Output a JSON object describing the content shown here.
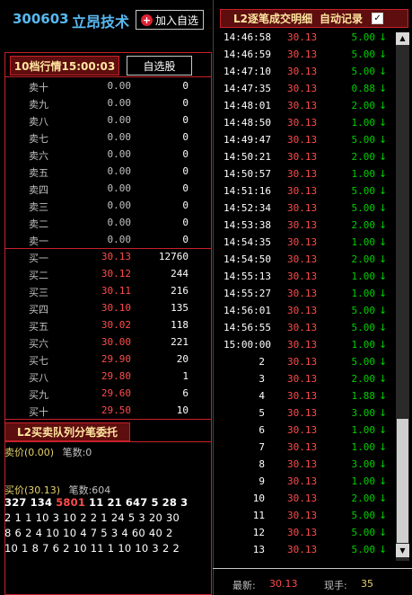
{
  "header": {
    "code": "300603",
    "name": "立昂技术",
    "add_button": "加入自选"
  },
  "tabs": {
    "quote10": "10档行情15:00:03",
    "favorites": "自选股"
  },
  "sells": [
    {
      "label": "卖十",
      "price": "0.00",
      "vol": "0"
    },
    {
      "label": "卖九",
      "price": "0.00",
      "vol": "0"
    },
    {
      "label": "卖八",
      "price": "0.00",
      "vol": "0"
    },
    {
      "label": "卖七",
      "price": "0.00",
      "vol": "0"
    },
    {
      "label": "卖六",
      "price": "0.00",
      "vol": "0"
    },
    {
      "label": "卖五",
      "price": "0.00",
      "vol": "0"
    },
    {
      "label": "卖四",
      "price": "0.00",
      "vol": "0"
    },
    {
      "label": "卖三",
      "price": "0.00",
      "vol": "0"
    },
    {
      "label": "卖二",
      "price": "0.00",
      "vol": "0"
    },
    {
      "label": "卖一",
      "price": "0.00",
      "vol": "0"
    }
  ],
  "buys": [
    {
      "label": "买一",
      "price": "30.13",
      "vol": "12760",
      "color": "red"
    },
    {
      "label": "买二",
      "price": "30.12",
      "vol": "244",
      "color": "red"
    },
    {
      "label": "买三",
      "price": "30.11",
      "vol": "216",
      "color": "red"
    },
    {
      "label": "买四",
      "price": "30.10",
      "vol": "135",
      "color": "red"
    },
    {
      "label": "买五",
      "price": "30.02",
      "vol": "118",
      "color": "red"
    },
    {
      "label": "买六",
      "price": "30.00",
      "vol": "221",
      "color": "red"
    },
    {
      "label": "买七",
      "price": "29.90",
      "vol": "20",
      "color": "red"
    },
    {
      "label": "买八",
      "price": "29.80",
      "vol": "1",
      "color": "red"
    },
    {
      "label": "买九",
      "price": "29.60",
      "vol": "6",
      "color": "red"
    },
    {
      "label": "买十",
      "price": "29.50",
      "vol": "10",
      "color": "red"
    }
  ],
  "queue": {
    "tab": "L2买卖队列分笔委托",
    "sell_label": "卖价(0.00)",
    "sell_count": "笔数:0",
    "buy_label": "买价(30.13)",
    "buy_count": "笔数:604",
    "orders": [
      [
        "327",
        "134",
        "5801",
        "11",
        "21",
        "647",
        "5",
        "28",
        "3"
      ],
      [
        "2",
        "1",
        "1",
        "10",
        "3",
        "10",
        "2",
        "2",
        "1",
        "24",
        "5",
        "3",
        "20",
        "30"
      ],
      [
        "8",
        "6",
        "2",
        "4",
        "10",
        "10",
        "4",
        "7",
        "5",
        "3",
        "4",
        "60",
        "40",
        "2"
      ],
      [
        "10",
        "1",
        "8",
        "7",
        "6",
        "2",
        "10",
        "11",
        "1",
        "10",
        "10",
        "3",
        "2",
        "2"
      ]
    ],
    "highlight": "5801"
  },
  "detail": {
    "tab": "L2逐笔成交明细",
    "auto_label": "自动记录",
    "auto_checked": "✓"
  },
  "trades": [
    {
      "t": "14:46:58",
      "p": "30.13",
      "v": "5.00"
    },
    {
      "t": "14:46:59",
      "p": "30.13",
      "v": "5.00"
    },
    {
      "t": "14:47:10",
      "p": "30.13",
      "v": "5.00"
    },
    {
      "t": "14:47:35",
      "p": "30.13",
      "v": "0.88"
    },
    {
      "t": "14:48:01",
      "p": "30.13",
      "v": "2.00"
    },
    {
      "t": "14:48:50",
      "p": "30.13",
      "v": "1.00"
    },
    {
      "t": "14:49:47",
      "p": "30.13",
      "v": "5.00"
    },
    {
      "t": "14:50:21",
      "p": "30.13",
      "v": "2.00"
    },
    {
      "t": "14:50:57",
      "p": "30.13",
      "v": "1.00"
    },
    {
      "t": "14:51:16",
      "p": "30.13",
      "v": "5.00"
    },
    {
      "t": "14:52:34",
      "p": "30.13",
      "v": "5.00"
    },
    {
      "t": "14:53:38",
      "p": "30.13",
      "v": "2.00"
    },
    {
      "t": "14:54:35",
      "p": "30.13",
      "v": "1.00"
    },
    {
      "t": "14:54:50",
      "p": "30.13",
      "v": "2.00"
    },
    {
      "t": "14:55:13",
      "p": "30.13",
      "v": "1.00"
    },
    {
      "t": "14:55:27",
      "p": "30.13",
      "v": "1.00"
    },
    {
      "t": "14:56:01",
      "p": "30.13",
      "v": "5.00"
    },
    {
      "t": "14:56:55",
      "p": "30.13",
      "v": "5.00"
    },
    {
      "t": "15:00:00",
      "p": "30.13",
      "v": "1.00"
    },
    {
      "t": "2",
      "p": "30.13",
      "v": "5.00"
    },
    {
      "t": "3",
      "p": "30.13",
      "v": "2.00"
    },
    {
      "t": "4",
      "p": "30.13",
      "v": "1.88"
    },
    {
      "t": "5",
      "p": "30.13",
      "v": "3.00"
    },
    {
      "t": "6",
      "p": "30.13",
      "v": "1.00"
    },
    {
      "t": "7",
      "p": "30.13",
      "v": "1.00"
    },
    {
      "t": "8",
      "p": "30.13",
      "v": "3.00"
    },
    {
      "t": "9",
      "p": "30.13",
      "v": "1.00"
    },
    {
      "t": "10",
      "p": "30.13",
      "v": "2.00"
    },
    {
      "t": "11",
      "p": "30.13",
      "v": "5.00"
    },
    {
      "t": "12",
      "p": "30.13",
      "v": "5.00"
    },
    {
      "t": "13",
      "p": "30.13",
      "v": "5.00"
    }
  ],
  "trade_arrow": "↓",
  "footer": {
    "latest_label": "最新:",
    "latest_value": "30.13",
    "hand_label": "现手:",
    "hand_value": "35"
  },
  "colors": {
    "up": "#ff4b4b",
    "down": "#00d000",
    "frame": "#c8202a",
    "tab_bg": "#5e0e0e"
  }
}
